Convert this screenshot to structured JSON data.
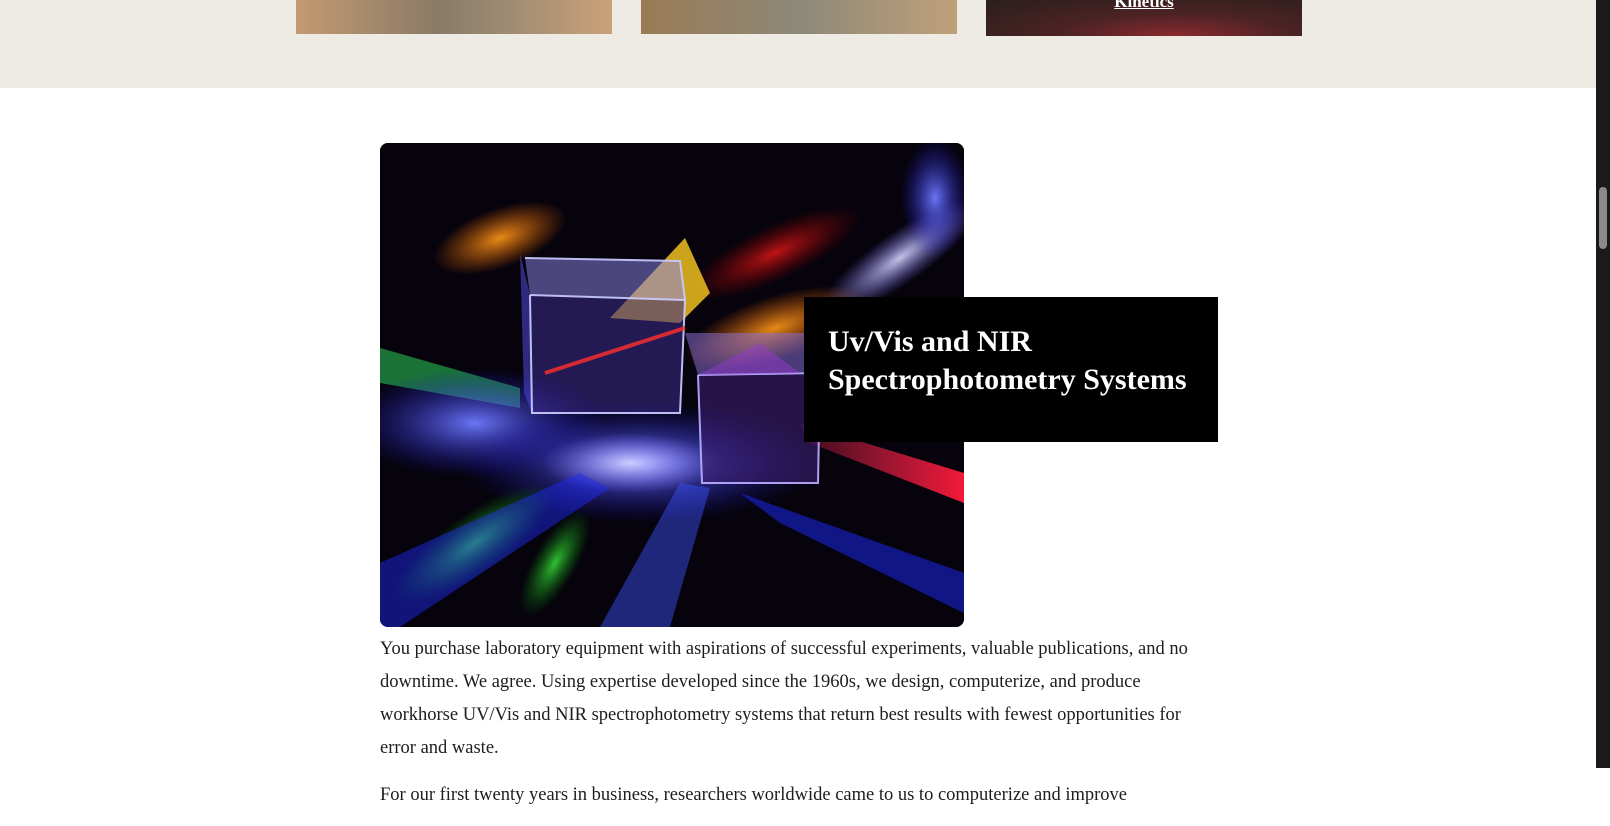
{
  "cards": [
    {
      "link": ""
    },
    {
      "link": ""
    },
    {
      "link": "Kinetics"
    }
  ],
  "hero": {
    "image_icon": "prism-cubes-image"
  },
  "section": {
    "title_line1": "Uv/Vis and NIR",
    "title_line2": "Spectrophotometry Systems",
    "paragraphs": [
      "You purchase laboratory equipment with aspirations of successful experiments, valuable publications, and no downtime. We agree. Using expertise developed since the 1960s, we design, computerize, and produce workhorse UV/Vis and NIR spectrophotometry systems that return best results with fewest opportunities for error and waste.",
      "For our first twenty years in business, researchers worldwide came to us to computerize and improve"
    ]
  }
}
